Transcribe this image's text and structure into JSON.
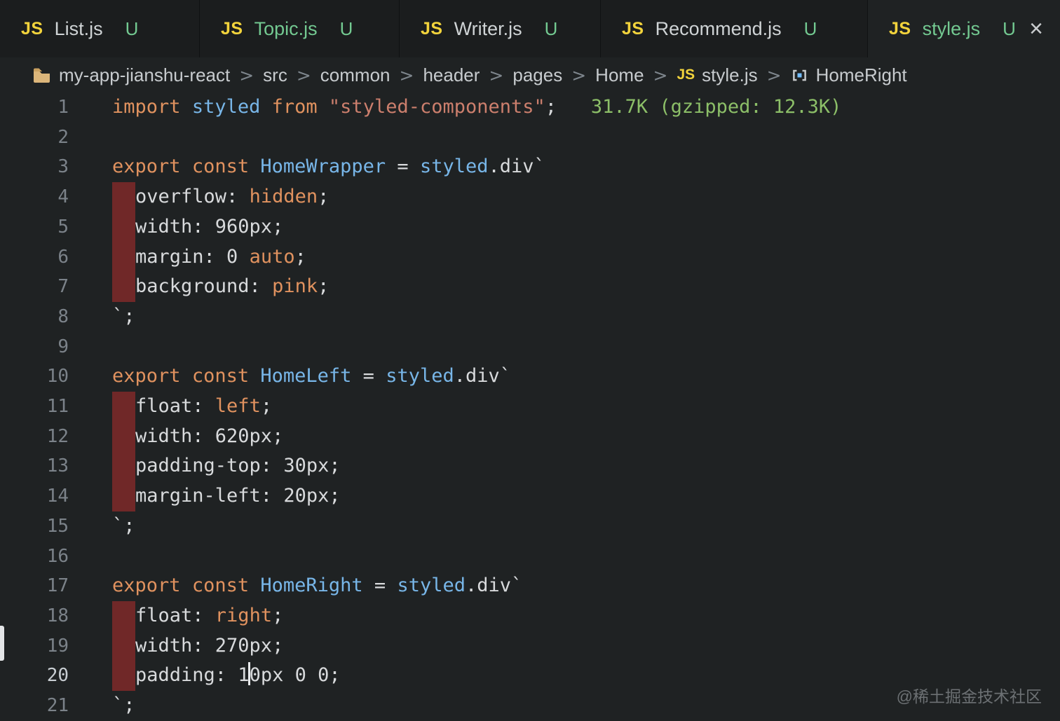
{
  "window": {
    "watermark": "@稀土掘金技术社区"
  },
  "palette": {
    "keyword": "#E0925F",
    "identifier": "#78B6E8",
    "string": "#CC7F6D",
    "default": "#D8DADC",
    "annotation": "#8CBF68",
    "line_number": "#7B8289",
    "line_number_active": "#C8CDD2",
    "indent_mark": "#702828",
    "untracked_green": "#73C991",
    "tab_label_plain": "#CFD3D5",
    "js_icon_yellow": "#F2D33C"
  },
  "tabs": [
    {
      "label": "List.js",
      "badge": "U",
      "active": false,
      "label_style": "plain"
    },
    {
      "label": "Topic.js",
      "badge": "U",
      "active": false,
      "label_style": "green"
    },
    {
      "label": "Writer.js",
      "badge": "U",
      "active": false,
      "label_style": "plain"
    },
    {
      "label": "Recommend.js",
      "badge": "U",
      "active": false,
      "label_style": "plain"
    },
    {
      "label": "style.js",
      "badge": "U",
      "active": true,
      "label_style": "green",
      "close": "×"
    }
  ],
  "breadcrumb": {
    "separator": ">",
    "items": [
      {
        "label": "my-app-jianshu-react",
        "icon": "folder-icon"
      },
      {
        "label": "src"
      },
      {
        "label": "common"
      },
      {
        "label": "header"
      },
      {
        "label": "pages"
      },
      {
        "label": "Home"
      },
      {
        "label": "style.js",
        "icon": "js-icon"
      },
      {
        "label": "HomeRight",
        "icon": "symbol-icon"
      }
    ]
  },
  "editor": {
    "cursor_line": 20,
    "lines": [
      {
        "n": 1,
        "tokens": [
          [
            "k",
            "import"
          ],
          [
            "d",
            " "
          ],
          [
            "v",
            "styled"
          ],
          [
            "d",
            " "
          ],
          [
            "k",
            "from"
          ],
          [
            "d",
            " "
          ],
          [
            "s",
            "\"styled-components\""
          ],
          [
            "d",
            ";   "
          ],
          [
            "g",
            "31.7K (gzipped: 12.3K)"
          ]
        ]
      },
      {
        "n": 2,
        "tokens": []
      },
      {
        "n": 3,
        "tokens": [
          [
            "k",
            "export"
          ],
          [
            "d",
            " "
          ],
          [
            "k",
            "const"
          ],
          [
            "d",
            " "
          ],
          [
            "v",
            "HomeWrapper"
          ],
          [
            "d",
            " = "
          ],
          [
            "v",
            "styled"
          ],
          [
            "d",
            ".div`"
          ]
        ]
      },
      {
        "n": 4,
        "tokens": [
          [
            "b",
            ""
          ],
          [
            "d",
            "overflow: "
          ],
          [
            "k",
            "hidden"
          ],
          [
            "d",
            ";"
          ]
        ]
      },
      {
        "n": 5,
        "tokens": [
          [
            "b",
            ""
          ],
          [
            "d",
            "width: 960px;"
          ]
        ]
      },
      {
        "n": 6,
        "tokens": [
          [
            "b",
            ""
          ],
          [
            "d",
            "margin: 0 "
          ],
          [
            "k",
            "auto"
          ],
          [
            "d",
            ";"
          ]
        ]
      },
      {
        "n": 7,
        "tokens": [
          [
            "b",
            ""
          ],
          [
            "d",
            "background: "
          ],
          [
            "k",
            "pink"
          ],
          [
            "d",
            ";"
          ]
        ]
      },
      {
        "n": 8,
        "tokens": [
          [
            "d",
            "`;"
          ]
        ]
      },
      {
        "n": 9,
        "tokens": []
      },
      {
        "n": 10,
        "tokens": [
          [
            "k",
            "export"
          ],
          [
            "d",
            " "
          ],
          [
            "k",
            "const"
          ],
          [
            "d",
            " "
          ],
          [
            "v",
            "HomeLeft"
          ],
          [
            "d",
            " = "
          ],
          [
            "v",
            "styled"
          ],
          [
            "d",
            ".div`"
          ]
        ]
      },
      {
        "n": 11,
        "tokens": [
          [
            "b",
            ""
          ],
          [
            "d",
            "float: "
          ],
          [
            "k",
            "left"
          ],
          [
            "d",
            ";"
          ]
        ]
      },
      {
        "n": 12,
        "tokens": [
          [
            "b",
            ""
          ],
          [
            "d",
            "width: 620px;"
          ]
        ]
      },
      {
        "n": 13,
        "tokens": [
          [
            "b",
            ""
          ],
          [
            "d",
            "padding-top: 30px;"
          ]
        ]
      },
      {
        "n": 14,
        "tokens": [
          [
            "b",
            ""
          ],
          [
            "d",
            "margin-left: 20px;"
          ]
        ]
      },
      {
        "n": 15,
        "tokens": [
          [
            "d",
            "`;"
          ]
        ]
      },
      {
        "n": 16,
        "tokens": []
      },
      {
        "n": 17,
        "tokens": [
          [
            "k",
            "export"
          ],
          [
            "d",
            " "
          ],
          [
            "k",
            "const"
          ],
          [
            "d",
            " "
          ],
          [
            "v",
            "HomeRight"
          ],
          [
            "d",
            " = "
          ],
          [
            "v",
            "styled"
          ],
          [
            "d",
            ".div`"
          ]
        ]
      },
      {
        "n": 18,
        "tokens": [
          [
            "b",
            ""
          ],
          [
            "d",
            "float: "
          ],
          [
            "k",
            "right"
          ],
          [
            "d",
            ";"
          ]
        ]
      },
      {
        "n": 19,
        "tokens": [
          [
            "b",
            ""
          ],
          [
            "d",
            "width: 270px;"
          ]
        ]
      },
      {
        "n": 20,
        "active": true,
        "tokens": [
          [
            "b",
            ""
          ],
          [
            "d",
            "padding: 1"
          ],
          [
            "c",
            ""
          ],
          [
            "d",
            "0px 0 0;"
          ]
        ]
      },
      {
        "n": 21,
        "tokens": [
          [
            "d",
            "`;"
          ]
        ]
      }
    ]
  }
}
